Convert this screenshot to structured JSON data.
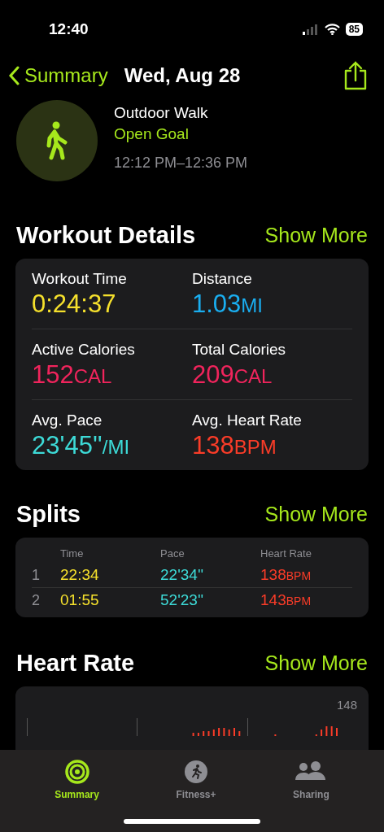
{
  "status_bar": {
    "time": "12:40",
    "battery": "85"
  },
  "nav": {
    "back_label": "Summary",
    "title": "Wed, Aug 28"
  },
  "workout": {
    "name": "Outdoor Walk",
    "goal": "Open Goal",
    "time_range": "12:12 PM–12:36 PM"
  },
  "details": {
    "title": "Workout Details",
    "action": "Show More",
    "metrics": [
      {
        "label": "Workout Time",
        "value": "0:24:37",
        "color": "#f5e02c"
      },
      {
        "label": "Distance",
        "value": "1.03",
        "unit": "MI",
        "color": "#1aaef0"
      },
      {
        "label": "Active Calories",
        "value": "152",
        "unit": "CAL",
        "color": "#f0245c"
      },
      {
        "label": "Total Calories",
        "value": "209",
        "unit": "CAL",
        "color": "#f0245c"
      },
      {
        "label": "Avg. Pace",
        "value": "23'45''",
        "unit": "/MI",
        "color": "#3ddad7"
      },
      {
        "label": "Avg. Heart Rate",
        "value": "138",
        "unit": "BPM",
        "color": "#fa3c28"
      }
    ]
  },
  "splits": {
    "title": "Splits",
    "action": "Show More",
    "columns": [
      "Time",
      "Pace",
      "Heart Rate"
    ],
    "rows": [
      {
        "index": "1",
        "time": "22:34",
        "pace": "22'34''",
        "heart_rate": "138",
        "unit": "BPM"
      },
      {
        "index": "2",
        "time": "01:55",
        "pace": "52'23''",
        "heart_rate": "143",
        "unit": "BPM"
      }
    ]
  },
  "heart_rate": {
    "title": "Heart Rate",
    "action": "Show More",
    "max_label": "148"
  },
  "tab_bar": [
    {
      "label": "Summary",
      "selected": true,
      "kind": "rings"
    },
    {
      "label": "Fitness+",
      "selected": false,
      "kind": "runner"
    },
    {
      "label": "Sharing",
      "selected": false,
      "kind": "people"
    }
  ]
}
